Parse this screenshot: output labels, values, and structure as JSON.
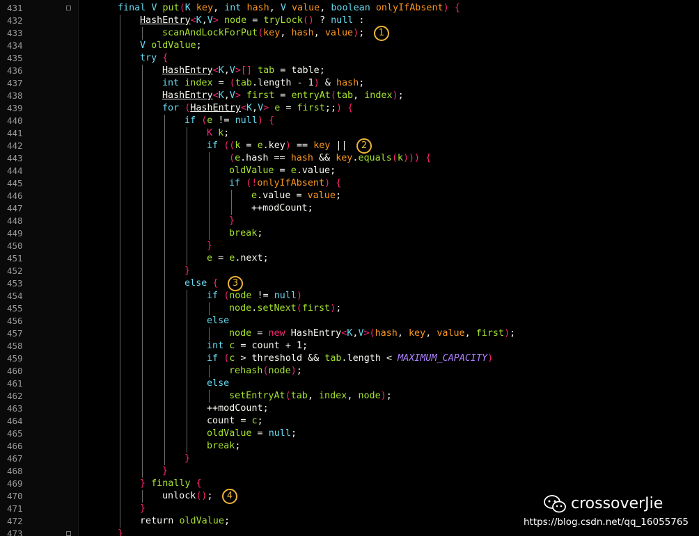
{
  "lines": [
    {
      "num": "431",
      "indent": 0,
      "tokens": [
        [
          "kw",
          "final "
        ],
        [
          "kw",
          "V "
        ],
        [
          "id",
          "put"
        ],
        [
          "br",
          "("
        ],
        [
          "kw",
          "K "
        ],
        [
          "par",
          "key"
        ],
        [
          "pl",
          ", "
        ],
        [
          "kw",
          "int "
        ],
        [
          "par",
          "hash"
        ],
        [
          "pl",
          ", "
        ],
        [
          "kw",
          "V "
        ],
        [
          "par",
          "value"
        ],
        [
          "pl",
          ", "
        ],
        [
          "kw",
          "boolean "
        ],
        [
          "par",
          "onlyIfAbsent"
        ],
        [
          "br",
          ")"
        ],
        [
          "pl",
          " "
        ],
        [
          "br",
          "{"
        ]
      ]
    },
    {
      "num": "432",
      "indent": 1,
      "tokens": [
        [
          "ty",
          "HashEntry"
        ],
        [
          "br",
          "<"
        ],
        [
          "kw",
          "K"
        ],
        [
          "pl",
          ","
        ],
        [
          "kw",
          "V"
        ],
        [
          "br",
          ">"
        ],
        [
          "pl",
          " "
        ],
        [
          "id",
          "node"
        ],
        [
          "pl",
          " = "
        ],
        [
          "id",
          "tryLock"
        ],
        [
          "br",
          "()"
        ],
        [
          "pl",
          " ? "
        ],
        [
          "kw",
          "null"
        ],
        [
          "pl",
          " :"
        ]
      ]
    },
    {
      "num": "433",
      "indent": 2,
      "tokens": [
        [
          "id",
          "scanAndLockForPut"
        ],
        [
          "br",
          "("
        ],
        [
          "par",
          "key"
        ],
        [
          "pl",
          ", "
        ],
        [
          "par",
          "hash"
        ],
        [
          "pl",
          ", "
        ],
        [
          "par",
          "value"
        ],
        [
          "br",
          ")"
        ],
        [
          "pl",
          ";"
        ]
      ]
    },
    {
      "num": "434",
      "indent": 1,
      "tokens": [
        [
          "kw",
          "V "
        ],
        [
          "id",
          "oldValue"
        ],
        [
          "pl",
          ";"
        ]
      ]
    },
    {
      "num": "435",
      "indent": 1,
      "tokens": [
        [
          "kw",
          "try"
        ],
        [
          "pl",
          " "
        ],
        [
          "br",
          "{"
        ]
      ]
    },
    {
      "num": "436",
      "indent": 2,
      "tokens": [
        [
          "ty",
          "HashEntry"
        ],
        [
          "br",
          "<"
        ],
        [
          "kw",
          "K"
        ],
        [
          "pl",
          ","
        ],
        [
          "kw",
          "V"
        ],
        [
          "br",
          ">"
        ],
        [
          "br",
          "[]"
        ],
        [
          "pl",
          " "
        ],
        [
          "id",
          "tab"
        ],
        [
          "pl",
          " = table;"
        ]
      ]
    },
    {
      "num": "437",
      "indent": 2,
      "tokens": [
        [
          "kw",
          "int "
        ],
        [
          "id",
          "index"
        ],
        [
          "pl",
          " = "
        ],
        [
          "br",
          "("
        ],
        [
          "id",
          "tab"
        ],
        [
          "pl",
          ".length - "
        ],
        [
          "pl",
          "1"
        ],
        [
          "br",
          ")"
        ],
        [
          "pl",
          " & "
        ],
        [
          "par",
          "hash"
        ],
        [
          "pl",
          ";"
        ]
      ]
    },
    {
      "num": "438",
      "indent": 2,
      "tokens": [
        [
          "ty",
          "HashEntry"
        ],
        [
          "br",
          "<"
        ],
        [
          "kw",
          "K"
        ],
        [
          "pl",
          ","
        ],
        [
          "kw",
          "V"
        ],
        [
          "br",
          ">"
        ],
        [
          "pl",
          " "
        ],
        [
          "id",
          "first"
        ],
        [
          "pl",
          " = "
        ],
        [
          "id",
          "entryAt"
        ],
        [
          "br",
          "("
        ],
        [
          "id",
          "tab"
        ],
        [
          "pl",
          ", "
        ],
        [
          "id",
          "index"
        ],
        [
          "br",
          ")"
        ],
        [
          "pl",
          ";"
        ]
      ]
    },
    {
      "num": "439",
      "indent": 2,
      "tokens": [
        [
          "kw",
          "for"
        ],
        [
          "pl",
          " "
        ],
        [
          "br",
          "("
        ],
        [
          "ty",
          "HashEntry"
        ],
        [
          "br",
          "<"
        ],
        [
          "kw",
          "K"
        ],
        [
          "pl",
          ","
        ],
        [
          "kw",
          "V"
        ],
        [
          "br",
          ">"
        ],
        [
          "pl",
          " "
        ],
        [
          "id",
          "e"
        ],
        [
          "pl",
          " = "
        ],
        [
          "id",
          "first"
        ],
        [
          "pl",
          ";;"
        ],
        [
          "br",
          ")"
        ],
        [
          "pl",
          " "
        ],
        [
          "br",
          "{"
        ]
      ]
    },
    {
      "num": "440",
      "indent": 3,
      "tokens": [
        [
          "kw",
          "if"
        ],
        [
          "pl",
          " "
        ],
        [
          "br",
          "("
        ],
        [
          "id",
          "e"
        ],
        [
          "pl",
          " != "
        ],
        [
          "kw",
          "null"
        ],
        [
          "br",
          ")"
        ],
        [
          "pl",
          " "
        ],
        [
          "br",
          "{"
        ]
      ]
    },
    {
      "num": "441",
      "indent": 4,
      "tokens": [
        [
          "br",
          "K "
        ],
        [
          "id",
          "k"
        ],
        [
          "pl",
          ";"
        ]
      ]
    },
    {
      "num": "442",
      "indent": 4,
      "tokens": [
        [
          "kw",
          "if"
        ],
        [
          "pl",
          " "
        ],
        [
          "br",
          "(("
        ],
        [
          "id",
          "k"
        ],
        [
          "pl",
          " = "
        ],
        [
          "id",
          "e"
        ],
        [
          "pl",
          ".key"
        ],
        [
          "br",
          ")"
        ],
        [
          "pl",
          " == "
        ],
        [
          "par",
          "key"
        ],
        [
          "pl",
          " ||"
        ]
      ]
    },
    {
      "num": "443",
      "indent": 5,
      "tokens": [
        [
          "br",
          "("
        ],
        [
          "id",
          "e"
        ],
        [
          "pl",
          ".hash == "
        ],
        [
          "par",
          "hash"
        ],
        [
          "pl",
          " && "
        ],
        [
          "par",
          "key"
        ],
        [
          "pl",
          "."
        ],
        [
          "id",
          "equals"
        ],
        [
          "br",
          "("
        ],
        [
          "id",
          "k"
        ],
        [
          "br",
          ")))"
        ],
        [
          "pl",
          " "
        ],
        [
          "br",
          "{"
        ]
      ]
    },
    {
      "num": "444",
      "indent": 5,
      "tokens": [
        [
          "id",
          "oldValue"
        ],
        [
          "pl",
          " = "
        ],
        [
          "id",
          "e"
        ],
        [
          "pl",
          ".value;"
        ]
      ]
    },
    {
      "num": "445",
      "indent": 5,
      "tokens": [
        [
          "kw",
          "if"
        ],
        [
          "pl",
          " "
        ],
        [
          "br",
          "(!"
        ],
        [
          "par",
          "onlyIfAbsent"
        ],
        [
          "br",
          ")"
        ],
        [
          "pl",
          " "
        ],
        [
          "br",
          "{"
        ]
      ]
    },
    {
      "num": "446",
      "indent": 6,
      "tokens": [
        [
          "id",
          "e"
        ],
        [
          "pl",
          ".value = "
        ],
        [
          "par",
          "value"
        ],
        [
          "pl",
          ";"
        ]
      ]
    },
    {
      "num": "447",
      "indent": 6,
      "tokens": [
        [
          "pl",
          "++modCount;"
        ]
      ]
    },
    {
      "num": "448",
      "indent": 5,
      "tokens": [
        [
          "br",
          "}"
        ]
      ]
    },
    {
      "num": "449",
      "indent": 5,
      "tokens": [
        [
          "id",
          "break"
        ],
        [
          "pl",
          ";"
        ]
      ]
    },
    {
      "num": "450",
      "indent": 4,
      "tokens": [
        [
          "br",
          "}"
        ]
      ]
    },
    {
      "num": "451",
      "indent": 4,
      "tokens": [
        [
          "id",
          "e"
        ],
        [
          "pl",
          " = "
        ],
        [
          "id",
          "e"
        ],
        [
          "pl",
          ".next;"
        ]
      ]
    },
    {
      "num": "452",
      "indent": 3,
      "tokens": [
        [
          "br",
          "}"
        ]
      ]
    },
    {
      "num": "453",
      "indent": 3,
      "tokens": [
        [
          "kw",
          "else"
        ],
        [
          "pl",
          " "
        ],
        [
          "br",
          "{"
        ]
      ]
    },
    {
      "num": "454",
      "indent": 4,
      "tokens": [
        [
          "kw",
          "if"
        ],
        [
          "pl",
          " "
        ],
        [
          "br",
          "("
        ],
        [
          "id",
          "node"
        ],
        [
          "pl",
          " != "
        ],
        [
          "kw",
          "null"
        ],
        [
          "br",
          ")"
        ]
      ]
    },
    {
      "num": "455",
      "indent": 5,
      "tokens": [
        [
          "id",
          "node"
        ],
        [
          "pl",
          "."
        ],
        [
          "id",
          "setNext"
        ],
        [
          "br",
          "("
        ],
        [
          "id",
          "first"
        ],
        [
          "br",
          ")"
        ],
        [
          "pl",
          ";"
        ]
      ]
    },
    {
      "num": "456",
      "indent": 4,
      "tokens": [
        [
          "kw",
          "else"
        ]
      ]
    },
    {
      "num": "457",
      "indent": 5,
      "tokens": [
        [
          "id",
          "node"
        ],
        [
          "pl",
          " = "
        ],
        [
          "br",
          "new "
        ],
        [
          "pl",
          "HashEntry"
        ],
        [
          "br",
          "<"
        ],
        [
          "kw",
          "K"
        ],
        [
          "pl",
          ","
        ],
        [
          "kw",
          "V"
        ],
        [
          "br",
          ">("
        ],
        [
          "par",
          "hash"
        ],
        [
          "pl",
          ", "
        ],
        [
          "par",
          "key"
        ],
        [
          "pl",
          ", "
        ],
        [
          "par",
          "value"
        ],
        [
          "pl",
          ", "
        ],
        [
          "id",
          "first"
        ],
        [
          "br",
          ")"
        ],
        [
          "pl",
          ";"
        ]
      ]
    },
    {
      "num": "458",
      "indent": 4,
      "tokens": [
        [
          "kw",
          "int "
        ],
        [
          "id",
          "c"
        ],
        [
          "pl",
          " = count + 1;"
        ]
      ]
    },
    {
      "num": "459",
      "indent": 4,
      "tokens": [
        [
          "kw",
          "if"
        ],
        [
          "pl",
          " "
        ],
        [
          "br",
          "("
        ],
        [
          "id",
          "c"
        ],
        [
          "pl",
          " > threshold && "
        ],
        [
          "id",
          "tab"
        ],
        [
          "pl",
          ".length < "
        ],
        [
          "cs",
          "MAXIMUM_CAPACITY"
        ],
        [
          "br",
          ")"
        ]
      ]
    },
    {
      "num": "460",
      "indent": 5,
      "tokens": [
        [
          "id",
          "rehash"
        ],
        [
          "br",
          "("
        ],
        [
          "id",
          "node"
        ],
        [
          "br",
          ")"
        ],
        [
          "pl",
          ";"
        ]
      ]
    },
    {
      "num": "461",
      "indent": 4,
      "tokens": [
        [
          "kw",
          "else"
        ]
      ]
    },
    {
      "num": "462",
      "indent": 5,
      "tokens": [
        [
          "id",
          "setEntryAt"
        ],
        [
          "br",
          "("
        ],
        [
          "id",
          "tab"
        ],
        [
          "pl",
          ", "
        ],
        [
          "id",
          "index"
        ],
        [
          "pl",
          ", "
        ],
        [
          "id",
          "node"
        ],
        [
          "br",
          ")"
        ],
        [
          "pl",
          ";"
        ]
      ]
    },
    {
      "num": "463",
      "indent": 4,
      "tokens": [
        [
          "pl",
          "++modCount;"
        ]
      ]
    },
    {
      "num": "464",
      "indent": 4,
      "tokens": [
        [
          "pl",
          "count = "
        ],
        [
          "id",
          "c"
        ],
        [
          "pl",
          ";"
        ]
      ]
    },
    {
      "num": "465",
      "indent": 4,
      "tokens": [
        [
          "id",
          "oldValue"
        ],
        [
          "pl",
          " = "
        ],
        [
          "kw",
          "null"
        ],
        [
          "pl",
          ";"
        ]
      ]
    },
    {
      "num": "466",
      "indent": 4,
      "tokens": [
        [
          "id",
          "break"
        ],
        [
          "pl",
          ";"
        ]
      ]
    },
    {
      "num": "467",
      "indent": 3,
      "tokens": [
        [
          "br",
          "}"
        ]
      ]
    },
    {
      "num": "468",
      "indent": 2,
      "tokens": [
        [
          "br",
          "}"
        ]
      ]
    },
    {
      "num": "469",
      "indent": 1,
      "tokens": [
        [
          "br",
          "}"
        ],
        [
          "pl",
          " "
        ],
        [
          "id",
          "finally"
        ],
        [
          "pl",
          " "
        ],
        [
          "br",
          "{"
        ]
      ]
    },
    {
      "num": "470",
      "indent": 2,
      "tokens": [
        [
          "pl",
          "unlock"
        ],
        [
          "br",
          "()"
        ],
        [
          "pl",
          ";"
        ]
      ]
    },
    {
      "num": "471",
      "indent": 1,
      "tokens": [
        [
          "br",
          "}"
        ]
      ]
    },
    {
      "num": "472",
      "indent": 1,
      "tokens": [
        [
          "pl",
          "return "
        ],
        [
          "id",
          "oldValue"
        ],
        [
          "pl",
          ";"
        ]
      ]
    },
    {
      "num": "473",
      "indent": 0,
      "tokens": [
        [
          "br",
          "}"
        ]
      ]
    }
  ],
  "markers": [
    {
      "label": "1",
      "line": "433"
    },
    {
      "label": "2",
      "line": "442"
    },
    {
      "label": "3",
      "line": "453"
    },
    {
      "label": "4",
      "line": "470"
    }
  ],
  "watermark": {
    "name": "crossoverJie",
    "url": "https://blog.csdn.net/qq_16055765",
    "icon": "wechat-icon"
  },
  "colors": {
    "background": "#000000",
    "keyword": "#66d9ef",
    "identifier": "#a6e22e",
    "parameter": "#fd971f",
    "brace": "#f92672",
    "constant": "#ae81ff",
    "marker": "#f0b43a"
  }
}
